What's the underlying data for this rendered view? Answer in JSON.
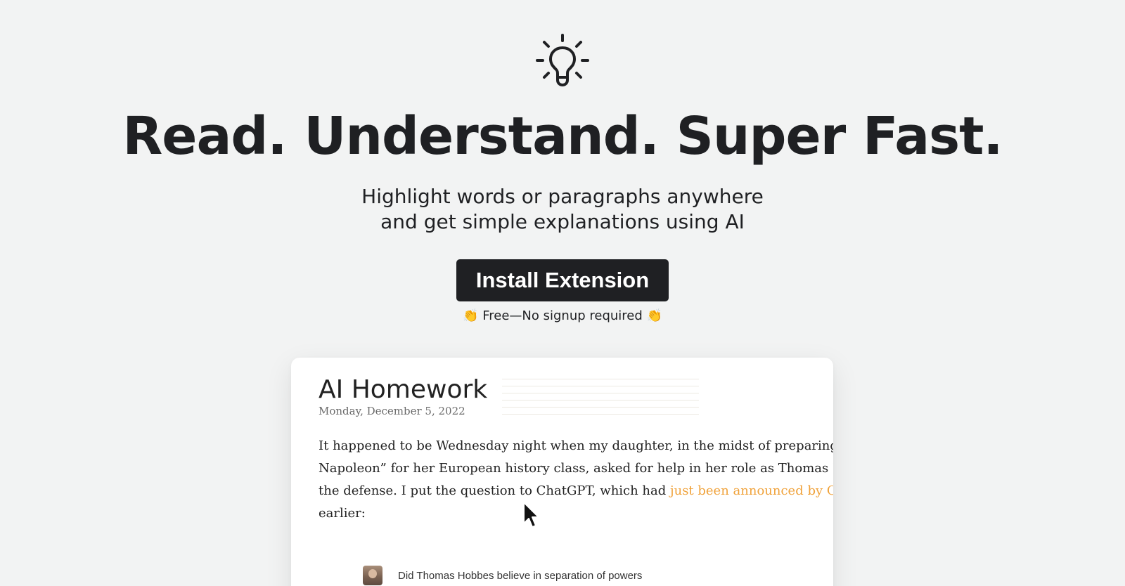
{
  "hero": {
    "icon": "lightbulb-icon",
    "title": "Read. Understand. Super Fast.",
    "subtitle_line1": "Highlight words or paragraphs anywhere",
    "subtitle_line2": "and get simple explanations using AI",
    "cta_label": "Install Extension",
    "note_emoji_left": "👏",
    "note_text": " Free—No signup required ",
    "note_emoji_right": "👏"
  },
  "preview": {
    "title": "AI Homework",
    "date": "Monday, December 5, 2022",
    "para_line1": "It happened to be Wednesday night when my daughter, in the midst of preparing for “T",
    "para_line2": "Napoleon” for her European history class, asked for help in her role as Thomas Hobbes",
    "para_line3_prefix": "the defense. I put the question to ChatGPT, which had ",
    "para_line3_link": "just been announced by OpenAI",
    "para_line4": "earlier:",
    "chat_question": "Did Thomas Hobbes believe in separation of powers"
  },
  "colors": {
    "background": "#f2f3f3",
    "text": "#1f2023",
    "button_bg": "#1f2023",
    "button_text": "#ffffff",
    "link": "#f0a23a"
  }
}
